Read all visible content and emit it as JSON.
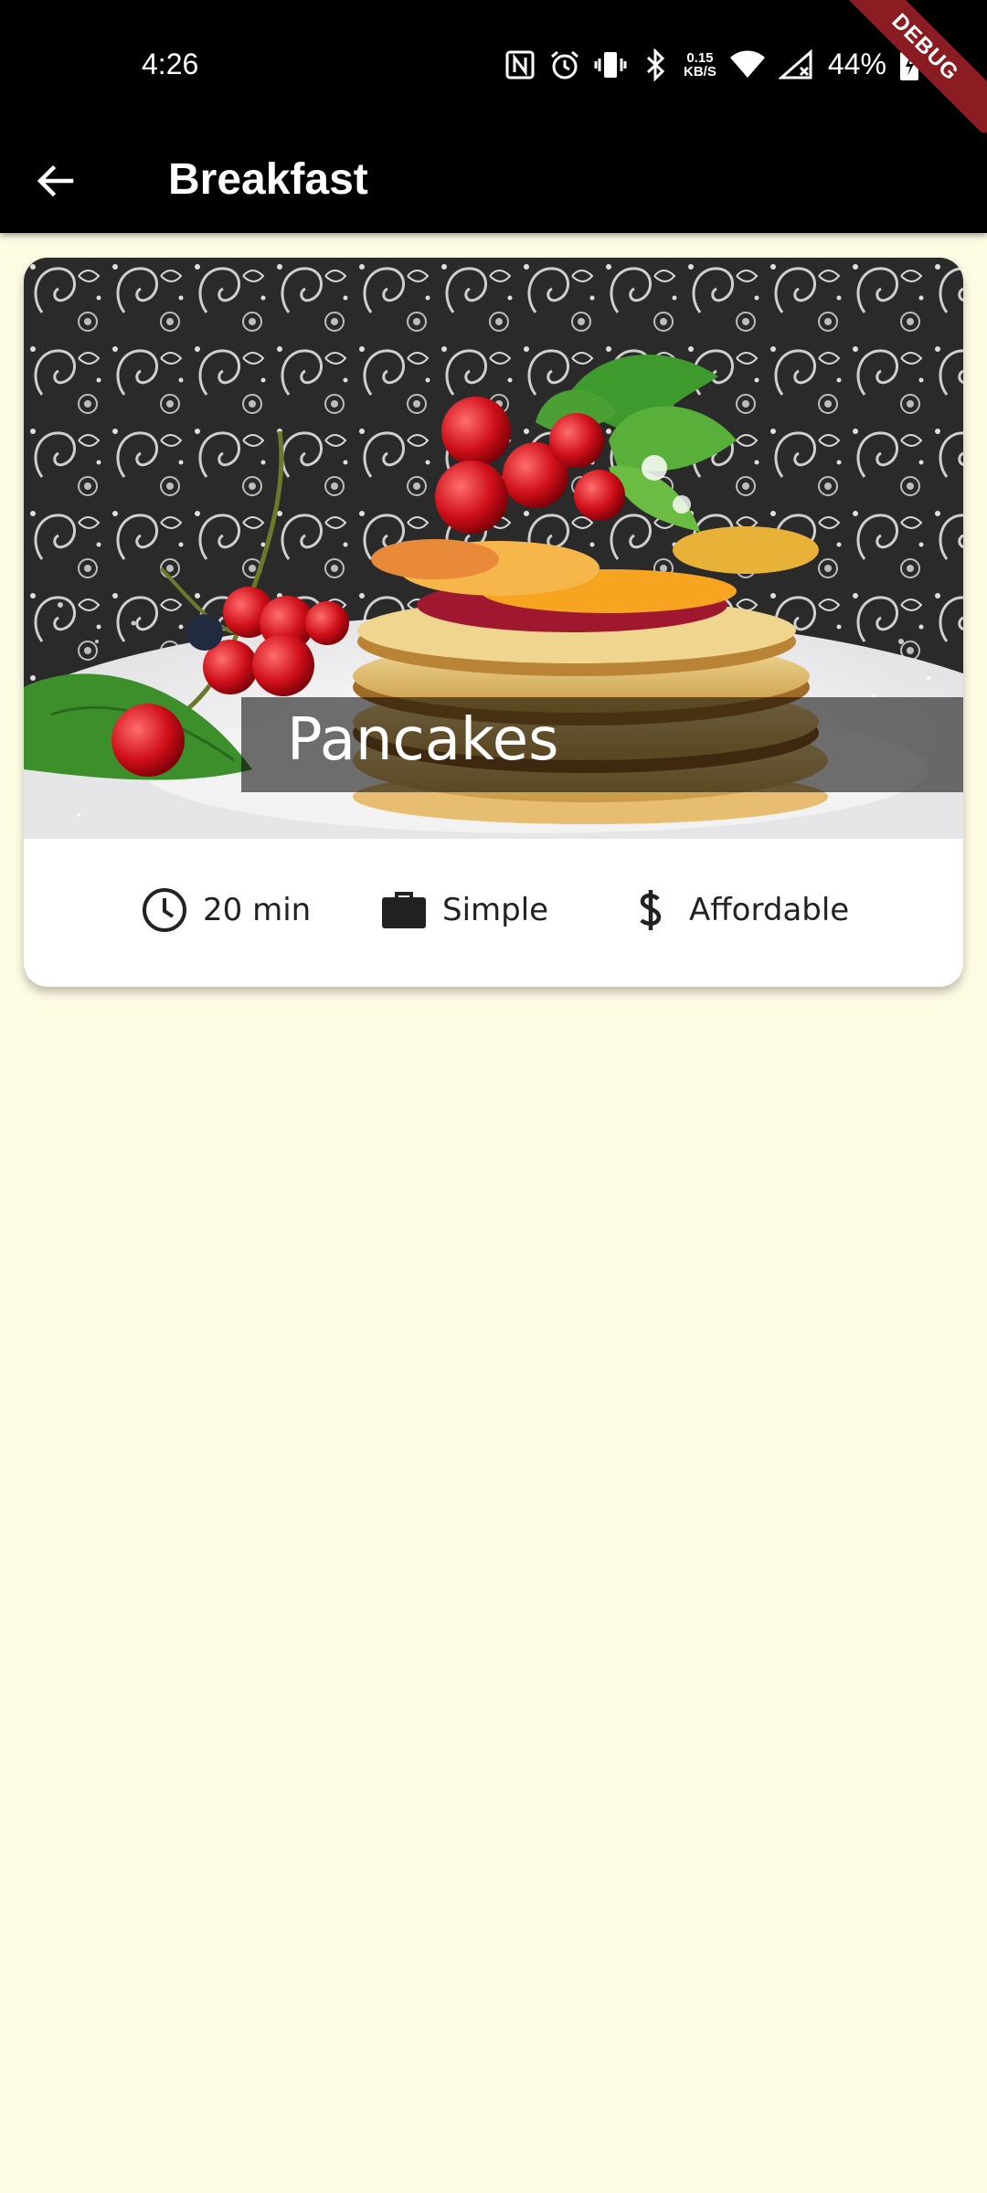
{
  "status_bar": {
    "time": "4:26",
    "speed_value": "0.15",
    "speed_unit": "KB/S",
    "battery_percent": "44%",
    "icons": [
      "nfc-icon",
      "alarm-icon",
      "vibrate-icon",
      "bluetooth-icon",
      "wifi-icon",
      "signal-icon",
      "battery-icon"
    ]
  },
  "debug_banner": "DEBUG",
  "app_bar": {
    "title": "Breakfast",
    "back_icon": "arrow-back-icon"
  },
  "recipe": {
    "title": "Pancakes",
    "duration": "20 min",
    "complexity": "Simple",
    "affordability": "Affordable",
    "image_subject": "pancakes-with-berries"
  },
  "colors": {
    "background": "#fefbe3",
    "app_bar": "#000000",
    "card": "#ffffff",
    "debug_banner": "#8b1c22"
  }
}
